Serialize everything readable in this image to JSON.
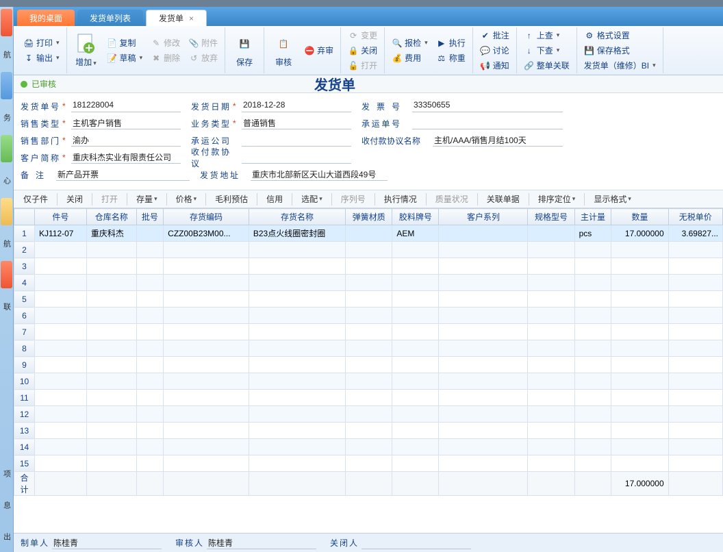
{
  "tabs": {
    "desktop": "我的桌面",
    "list": "发货单列表",
    "doc": "发货单"
  },
  "ribbon": {
    "print": "打印",
    "export": "输出",
    "add": "增加",
    "copy": "复制",
    "modify": "修改",
    "attach": "附件",
    "draft": "草稿",
    "delete": "删除",
    "discard": "放弃",
    "save": "保存",
    "audit": "审核",
    "giveup": "弃审",
    "change": "变更",
    "close": "关闭",
    "open": "打开",
    "inspect": "报检",
    "fee": "费用",
    "execute": "执行",
    "weigh": "称重",
    "approve": "批注",
    "discuss": "讨论",
    "notify": "通知",
    "lookup": "上查",
    "lookdown": "下查",
    "linkall": "整单关联",
    "formatset": "格式设置",
    "saveformat": "保存格式",
    "doctype": "发货单（维修）BI"
  },
  "status": {
    "text": "已审核",
    "title": "发货单"
  },
  "form": {
    "shipno_label": "发货单号",
    "shipno": "181228004",
    "saletype_label": "销售类型",
    "saletype": "主机客户销售",
    "dept_label": "销售部门",
    "dept": "渝办",
    "cust_label": "客户简称",
    "cust": "重庆科杰实业有限责任公司",
    "remark_label": "备注",
    "remark": "新产品开票",
    "shipdate_label": "发货日期",
    "shipdate": "2018-12-28",
    "biztype_label": "业务类型",
    "biztype": "普通销售",
    "carrier_label": "承运公司",
    "carrier": "",
    "payagree_label": "收付款协议",
    "payagree": "",
    "shipaddr_label": "发货地址",
    "shipaddr": "重庆市北部新区天山大道西段49号",
    "invoice_label": "发票号",
    "invoice": "33350655",
    "carryno_label": "承运单号",
    "carryno": "",
    "payname_label": "收付款协议名称",
    "payname": "主机/AAA/销售月结100天"
  },
  "tabletools": {
    "onlysub": "仅子件",
    "close": "关闭",
    "open": "打开",
    "stock": "存量",
    "price": "价格",
    "gross": "毛利预估",
    "credit": "信用",
    "mix": "选配",
    "seq": "序列号",
    "execstat": "执行情况",
    "quality": "质量状况",
    "related": "关联单据",
    "sort": "排序定位",
    "display": "显示格式"
  },
  "columns": {
    "partno": "件号",
    "wh": "仓库名称",
    "lot": "批号",
    "invcode": "存货编码",
    "invname": "存货名称",
    "spring": "弹簧材质",
    "rubber": "胶料牌号",
    "custseries": "客户系列",
    "spec": "规格型号",
    "uom": "主计量",
    "qty": "数量",
    "price": "无税单价"
  },
  "row": {
    "partno": "KJ112-07",
    "wh": "重庆科杰",
    "lot": "",
    "invcode": "CZZ00B23M00...",
    "invname": "B23点火线圈密封圈",
    "spring": "",
    "rubber": "AEM",
    "custseries": "",
    "spec": "",
    "uom": "pcs",
    "qty": "17.000000",
    "price": "3.69827..."
  },
  "total": {
    "label": "合计",
    "qty": "17.000000"
  },
  "footer": {
    "creator_label": "制单人",
    "creator": "陈桂青",
    "auditor_label": "审核人",
    "auditor": "陈桂青",
    "closer_label": "关闭人",
    "closer": ""
  }
}
